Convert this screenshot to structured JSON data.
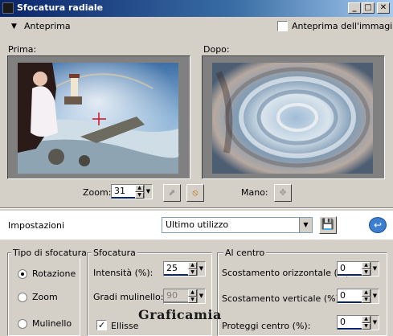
{
  "window": {
    "title": "Sfocatura radiale",
    "btn_min": "_",
    "btn_max": "□",
    "btn_close": "✕"
  },
  "preview_bar": {
    "toggle_label": "Anteprima",
    "image_preview_label": "Anteprima dell'immagine"
  },
  "panes": {
    "before_label": "Prima:",
    "after_label": "Dopo:"
  },
  "zoom": {
    "label": "Zoom:",
    "value": "31",
    "pan_label": "Mano:"
  },
  "settings": {
    "label": "Impostazioni",
    "preset_value": "Ultimo utilizzo"
  },
  "blur_type": {
    "title": "Tipo di sfocatura",
    "options": [
      "Rotazione",
      "Zoom",
      "Mulinello"
    ],
    "selected_index": 0
  },
  "blur": {
    "title": "Sfocatura",
    "intensity_label": "Intensità (%):",
    "intensity_value": "25",
    "twirl_label": "Gradi mulinello:",
    "twirl_value": "90",
    "ellipse_label": "Ellisse",
    "ellipse_checked": true
  },
  "center": {
    "title": "Al centro",
    "h_offset_label": "Scostamento orizzontale (%):",
    "h_offset_value": "0",
    "v_offset_label": "Scostamento verticale (%):",
    "v_offset_value": "0",
    "protect_label": "Proteggi centro (%):",
    "protect_value": "0"
  },
  "watermark": "Graficamia",
  "colors": {
    "titlebar_start": "#0a246a",
    "titlebar_end": "#a6caf0",
    "face": "#d4d0c8"
  }
}
